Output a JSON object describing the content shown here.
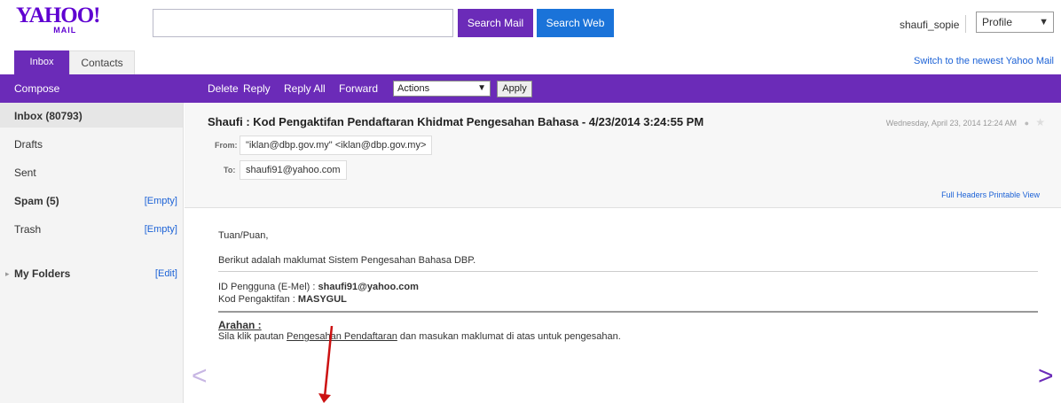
{
  "logo": {
    "text": "YAHOO!",
    "sub": "MAIL",
    "color": "#5f01d1"
  },
  "search": {
    "value": "",
    "placeholder": "",
    "search_mail": "Search Mail",
    "search_web": "Search Web"
  },
  "user": {
    "name": "shaufi_sopie",
    "profile_selected": "Profile"
  },
  "tabs": [
    {
      "label": "Inbox"
    },
    {
      "label": "Contacts"
    }
  ],
  "switch_link": "Switch to the newest Yahoo Mail",
  "toolbar": {
    "compose": "Compose",
    "delete": "Delete",
    "reply": "Reply",
    "reply_all": "Reply All",
    "forward": "Forward",
    "actions_selected": "Actions",
    "apply": "Apply"
  },
  "sidebar": {
    "items": [
      {
        "label": "Inbox (80793)"
      },
      {
        "label": "Drafts"
      },
      {
        "label": "Sent"
      },
      {
        "label": "Spam (5)",
        "action": "[Empty]"
      },
      {
        "label": "Trash",
        "action": "[Empty]"
      }
    ],
    "my_folders": {
      "label": "My Folders",
      "action": "[Edit]"
    }
  },
  "message": {
    "subject": "Shaufi : Kod Pengaktifan Pendaftaran Khidmat Pengesahan Bahasa - 4/23/2014 3:24:55 PM",
    "date": "Wednesday, April 23, 2014 12:24 AM",
    "from_label": "From:",
    "from_value": "\"iklan@dbp.gov.my\" <iklan@dbp.gov.my>",
    "to_label": "To:",
    "to_value": "shaufi91@yahoo.com",
    "full_headers": "Full Headers",
    "printable_view": "Printable View"
  },
  "body": {
    "greeting": "Tuan/Puan,",
    "intro": "Berikut adalah maklumat Sistem Pengesahan Bahasa DBP.",
    "id_label": "ID Pengguna (E-Mel) : ",
    "id_value": "shaufi91@yahoo.com",
    "code_label": "Kod Pengaktifan : ",
    "code_value": "MASYGUL",
    "arahan": "Arahan :",
    "instr_before": "Sila klik pautan ",
    "instr_link": "Pengesahan Pendaftaran",
    "instr_after": " dan masukan maklumat di atas untuk pengesahan."
  },
  "colors": {
    "accent": "#6b2bb8",
    "link": "#1c62d6",
    "search_web": "#1a73d9",
    "arrow": "#cc1111"
  }
}
